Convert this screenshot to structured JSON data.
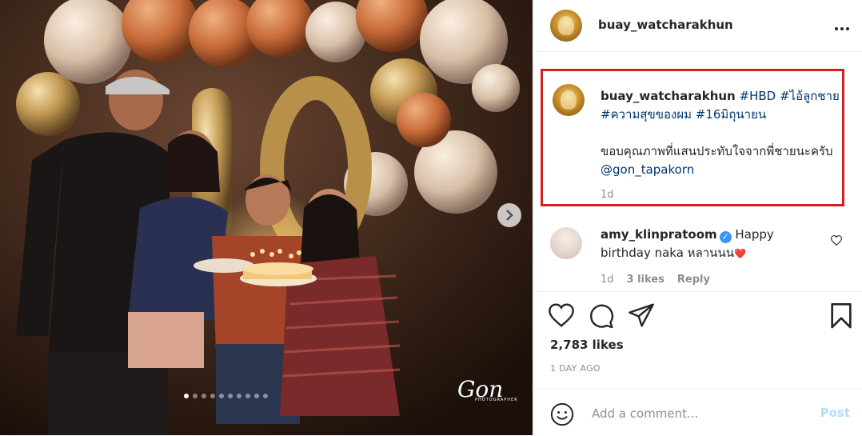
{
  "post": {
    "username": "buay_watcharakhun",
    "more_icon": "more-horizontal-icon",
    "watermark": "Gon",
    "watermark_sub": "PHOTOGRAPHER",
    "carousel": {
      "count": 10,
      "active": 0
    }
  },
  "caption": {
    "username": "buay_watcharakhun",
    "hashtags_line1": "#HBD #ไอ้ลูกชาย",
    "hashtags_line2": "#ความสุขของผม #16มิถุนายน",
    "body": "ขอบคุณภาพที่แสนประทับใจจากพี่ชายนะครับ",
    "mention": "@gon_tapakorn",
    "time": "1d"
  },
  "comment": {
    "username": "amy_klinpratoom",
    "verified": true,
    "text": "Happy birthday naka หลานนน",
    "emoji": "❤️",
    "time": "1d",
    "likes": "3 likes",
    "reply": "Reply"
  },
  "stats": {
    "likes": "2,783 likes",
    "time": "1 DAY AGO"
  },
  "composer": {
    "placeholder": "Add a comment...",
    "post_label": "Post"
  },
  "colors": {
    "link": "#00376b",
    "verified": "#3897f0",
    "highlight": "#d42020",
    "post_disabled": "#b2dffc"
  }
}
